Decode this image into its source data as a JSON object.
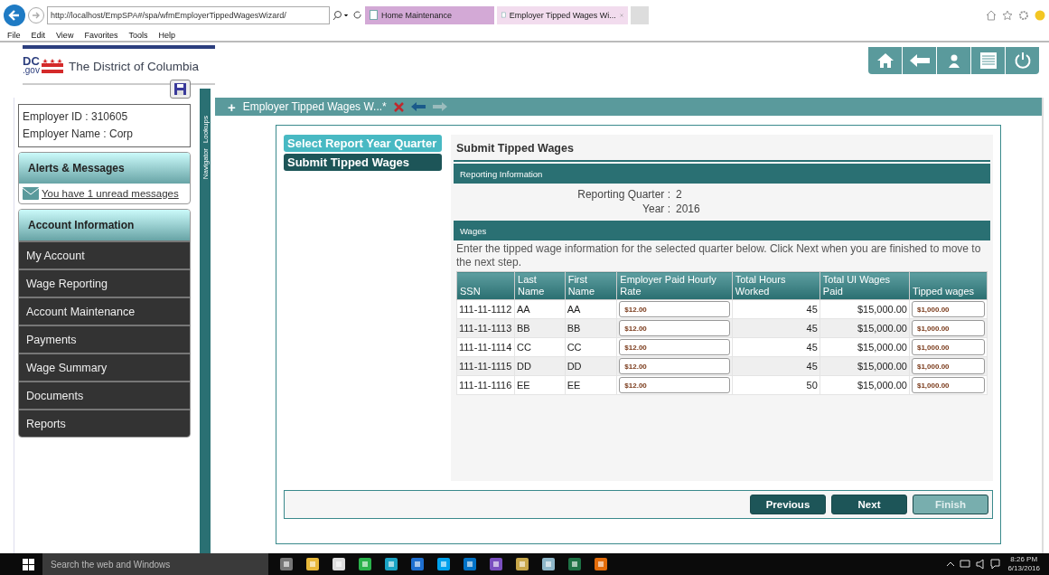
{
  "browser": {
    "url": "http://localhost/EmpSPA#/spa/wfmEmployerTippedWagesWizard/",
    "tabs": [
      {
        "label": "Home Maintenance",
        "selected": false
      },
      {
        "label": "Employer Tipped Wages Wi...",
        "selected": true
      }
    ],
    "menu": [
      "File",
      "Edit",
      "View",
      "Favorites",
      "Tools",
      "Help"
    ]
  },
  "header": {
    "logo_mark": "DC",
    "logo_sub": ".gov",
    "title": "The District of Columbia"
  },
  "sidebar": {
    "employer_id": "Employer ID : 310605",
    "employer_name": "Employer Name : Corp",
    "alerts": {
      "title": "Alerts & Messages",
      "message": "You have 1 unread messages"
    },
    "account": {
      "title": "Account Information",
      "items": [
        "My Account",
        "Wage Reporting",
        "Account Maintenance",
        "Payments",
        "Wage Summary",
        "Documents",
        "Reports"
      ]
    }
  },
  "side_strip": {
    "tabs": [
      "Lookups",
      "Navigator"
    ]
  },
  "tab_bar": {
    "plus": "+",
    "title": "Employer Tipped Wages W...*"
  },
  "wizard": {
    "steps": [
      {
        "label": "Select Report Year Quarter",
        "selected": false
      },
      {
        "label": "Submit Tipped Wages",
        "selected": true
      }
    ],
    "heading": "Submit Tipped Wages",
    "reporting": {
      "header": "Reporting Information",
      "fields": [
        {
          "label": "Reporting Quarter :",
          "value": "2"
        },
        {
          "label": "Year :",
          "value": "2016"
        }
      ]
    },
    "wages": {
      "header": "Wages",
      "instructions": "Enter the tipped wage information for the selected quarter below. Click Next when you are finished to move to the next step.",
      "columns": [
        "SSN",
        "Last Name",
        "First Name",
        "Employer Paid Hourly Rate",
        "Total Hours Worked",
        "Total UI Wages Paid",
        "Tipped wages"
      ],
      "rows": [
        {
          "ssn": "111-11-1112",
          "last": "AA",
          "first": "AA",
          "rate": "$12.00",
          "hours": "45",
          "ui_wages": "$15,000.00",
          "tipped": "$1,000.00"
        },
        {
          "ssn": "111-11-1113",
          "last": "BB",
          "first": "BB",
          "rate": "$12.00",
          "hours": "45",
          "ui_wages": "$15,000.00",
          "tipped": "$1,000.00"
        },
        {
          "ssn": "111-11-1114",
          "last": "CC",
          "first": "CC",
          "rate": "$12.00",
          "hours": "45",
          "ui_wages": "$15,000.00",
          "tipped": "$1,000.00"
        },
        {
          "ssn": "111-11-1115",
          "last": "DD",
          "first": "DD",
          "rate": "$12.00",
          "hours": "45",
          "ui_wages": "$15,000.00",
          "tipped": "$1,000.00"
        },
        {
          "ssn": "111-11-1116",
          "last": "EE",
          "first": "EE",
          "rate": "$12.00",
          "hours": "50",
          "ui_wages": "$15,000.00",
          "tipped": "$1,000.00"
        }
      ]
    },
    "buttons": [
      {
        "label": "Previous",
        "disabled": false
      },
      {
        "label": "Next",
        "disabled": false
      },
      {
        "label": "Finish",
        "disabled": true
      }
    ]
  },
  "taskbar": {
    "search_placeholder": "Search the web and Windows",
    "time": "8:26 PM",
    "date": "6/13/2016"
  }
}
